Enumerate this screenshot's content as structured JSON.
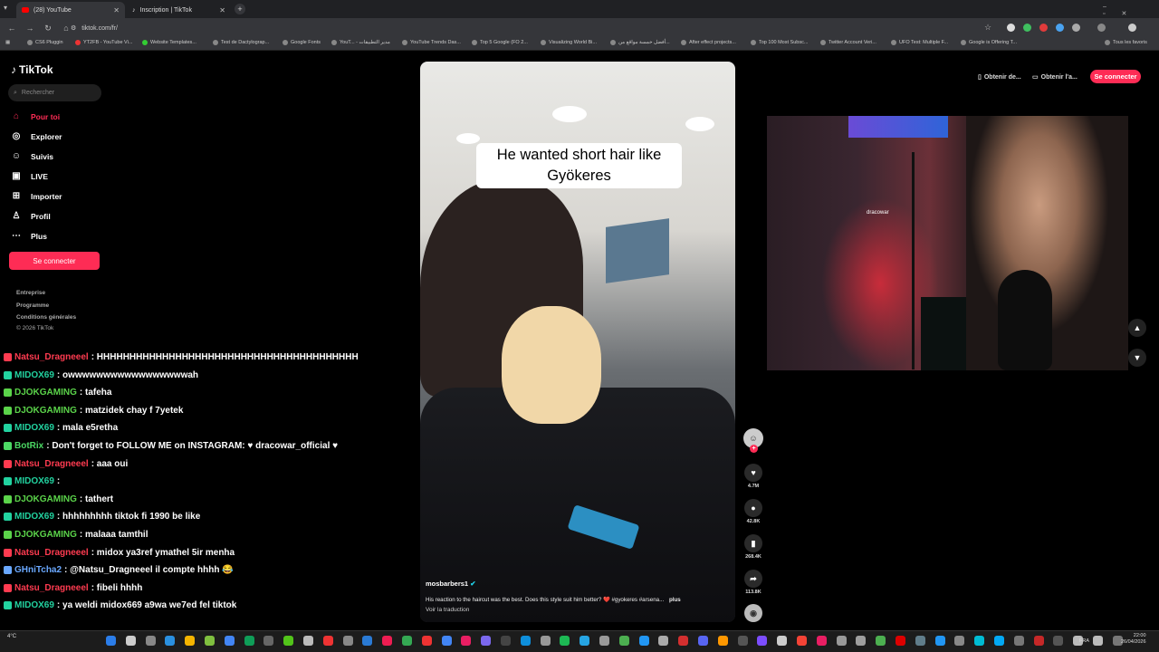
{
  "browser": {
    "tabs": [
      {
        "title": "(28) YouTube",
        "active": true
      },
      {
        "title": "Inscription | TikTok",
        "active": false
      }
    ],
    "url": "tiktok.com/fr/",
    "bookmarks": [
      "CS6 Pluggin",
      "YT2FB - YouTube Vi...",
      "Website Templates...",
      "Test de Dactylograp...",
      "Google Fonts",
      "YouT... - مدير التطبيقات",
      "YouTube Trends Das...",
      "Top 5 Google (FO 2...",
      "Visualizing World Bi...",
      "أفضل خمسة مواقع من...",
      "After effect projects...",
      "Top 100 Most Subsc...",
      "Twitter Account Veri...",
      "UFO Test: Multiple F...",
      "Google is Offering T..."
    ],
    "all_bookmarks": "Tous les favoris"
  },
  "tiktok": {
    "logo": "TikTok",
    "search_placeholder": "Rechercher",
    "nav": [
      {
        "icon": "home-icon",
        "glyph": "⌂",
        "label": "Pour toi",
        "active": true
      },
      {
        "icon": "compass-icon",
        "glyph": "◎",
        "label": "Explorer"
      },
      {
        "icon": "following-icon",
        "glyph": "☺",
        "label": "Suivis"
      },
      {
        "icon": "live-icon",
        "glyph": "▣",
        "label": "LIVE"
      },
      {
        "icon": "upload-icon",
        "glyph": "⊞",
        "label": "Importer"
      },
      {
        "icon": "profile-icon",
        "glyph": "♙",
        "label": "Profil"
      },
      {
        "icon": "more-icon",
        "glyph": "⋯",
        "label": "Plus"
      }
    ],
    "login_label": "Se connecter",
    "footer": [
      "Entreprise",
      "Programme",
      "Conditions générales",
      "© 2026 TikTok"
    ],
    "top_right": {
      "get_app": "Obtenir de...",
      "get_pc": "Obtenir l'a...",
      "login": "Se connecter"
    },
    "video": {
      "caption": "He wanted short hair like Gyökeres",
      "author": "mosbarbers1",
      "description": "His reaction to the haircut was the best. Does this style suit him better? ❤️ #gyokeres #arsena...",
      "more": "plus",
      "translate": "Voir la traduction"
    },
    "actions": [
      {
        "name": "like",
        "glyph": "♥",
        "count": "4.7M"
      },
      {
        "name": "comment",
        "glyph": "●",
        "count": "42.8K"
      },
      {
        "name": "bookmark",
        "glyph": "▮",
        "count": "268.4K"
      },
      {
        "name": "share",
        "glyph": "➦",
        "count": "113.8K"
      }
    ]
  },
  "chat": [
    {
      "user": "Natsu_Dragneeel",
      "color": "#ff3b50",
      "msg": ": HHHHHHHHHHHHHHHHHHHHHHHHHHHHHHHHHHHHHHHH"
    },
    {
      "user": "MIDOX69",
      "color": "#22d3a0",
      "msg": ": owwwwwwwwwwwwwwwwwah"
    },
    {
      "user": "DJOKGAMING",
      "color": "#5bd44a",
      "msg": ": tafeha"
    },
    {
      "user": "DJOKGAMING",
      "color": "#5bd44a",
      "msg": ": matzidek chay f 7yetek"
    },
    {
      "user": "MIDOX69",
      "color": "#22d3a0",
      "msg": ": mala e5retha"
    },
    {
      "user": "BotRix",
      "color": "#4cd964",
      "msg": ": Don't forget to FOLLOW ME on INSTAGRAM: ♥ dracowar_official ♥"
    },
    {
      "user": "Natsu_Dragneeel",
      "color": "#ff3b50",
      "msg": ": aaa oui"
    },
    {
      "user": "MIDOX69",
      "color": "#22d3a0",
      "msg": ":"
    },
    {
      "user": "DJOKGAMING",
      "color": "#5bd44a",
      "msg": ": tathert"
    },
    {
      "user": "MIDOX69",
      "color": "#22d3a0",
      "msg": ": hhhhhhhhh tiktok fi 1990 be like"
    },
    {
      "user": "DJOKGAMING",
      "color": "#5bd44a",
      "msg": ": malaaa tamthil"
    },
    {
      "user": "Natsu_Dragneeel",
      "color": "#ff3b50",
      "msg": ": midox ya3ref ymathel 5ir menha"
    },
    {
      "user": "GHniTcha2",
      "color": "#6aa8ff",
      "msg": ": @Natsu_Dragneeel il compte hhhh 😂"
    },
    {
      "user": "Natsu_Dragneeel",
      "color": "#ff3b50",
      "msg": ": fibeli hhhh"
    },
    {
      "user": "MIDOX69",
      "color": "#22d3a0",
      "msg": ": ya weldi midox669 a9wa we7ed fel tiktok"
    }
  ],
  "webcam": {
    "poster_text": "dracowar"
  },
  "taskbar": {
    "weather": "4°C",
    "lang": "FRA",
    "time": "22:00",
    "date": "26/04/2026"
  }
}
